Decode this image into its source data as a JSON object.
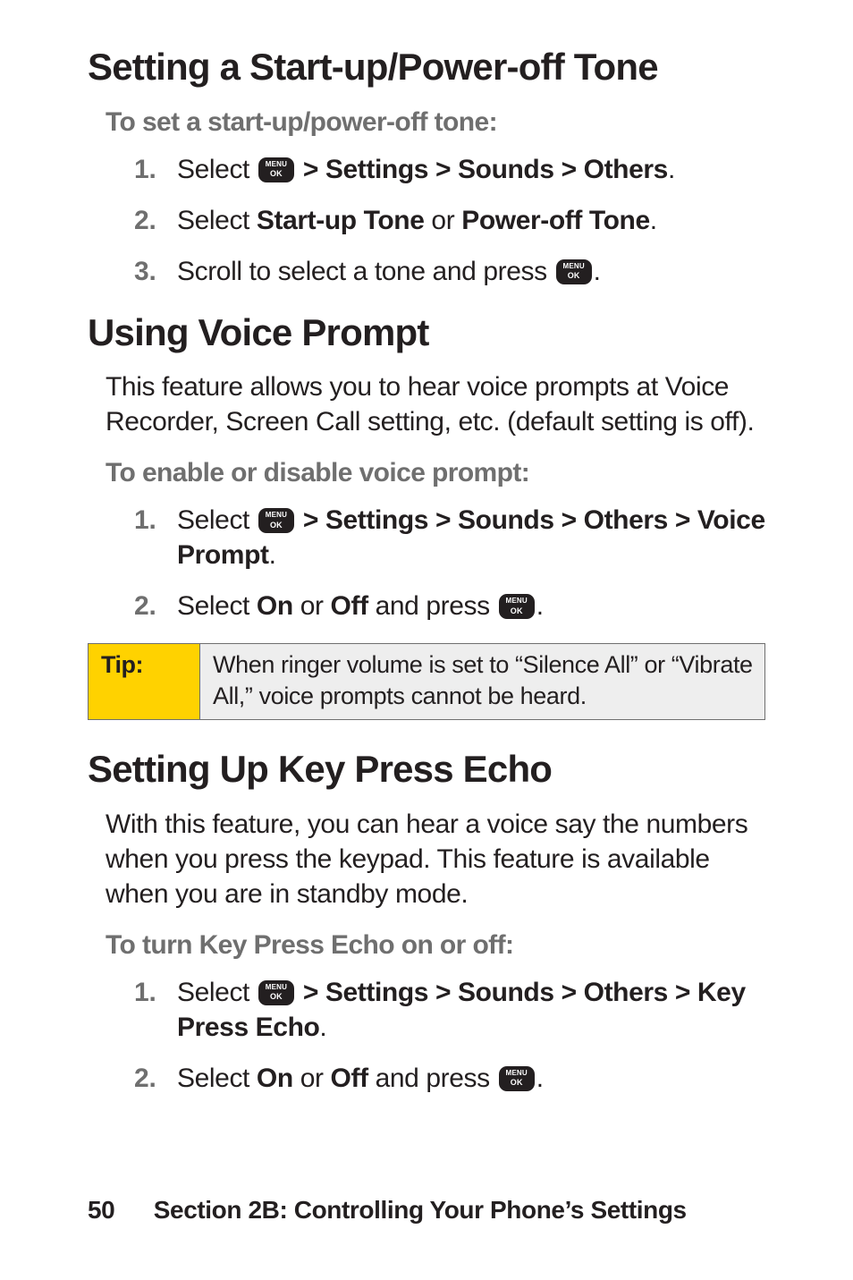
{
  "section1": {
    "heading": "Setting a Start-up/Power-off Tone",
    "subhead": "To set a start-up/power-off tone:",
    "steps": {
      "1": {
        "pre": "Select ",
        "post": " > Settings > Sounds > Others",
        "tail": "."
      },
      "2": {
        "pre": "Select ",
        "b1": "Start-up Tone",
        "mid": " or ",
        "b2": "Power-off Tone",
        "tail": "."
      },
      "3": {
        "pre": "Scroll to select a tone and press ",
        "tail": "."
      }
    }
  },
  "section2": {
    "heading": "Using Voice Prompt",
    "intro": "This feature allows you to hear voice prompts at Voice Recorder, Screen Call setting, etc. (default setting is off).",
    "subhead": "To enable or disable voice prompt:",
    "steps": {
      "1": {
        "pre": "Select ",
        "post": " > Settings > Sounds > Others > Voice Prompt",
        "tail": "."
      },
      "2": {
        "pre": "Select ",
        "b1": "On",
        "mid": " or ",
        "b2": "Off",
        "post": " and press ",
        "tail": "."
      }
    },
    "tip": {
      "label": "Tip:",
      "text": "When ringer volume is set to “Silence All” or “Vibrate All,” voice prompts cannot be heard."
    }
  },
  "section3": {
    "heading": "Setting Up Key Press Echo",
    "intro": "With this feature, you can hear a voice say the numbers when you press the keypad. This feature is available when you are in standby mode.",
    "subhead": "To turn Key Press Echo on or off:",
    "steps": {
      "1": {
        "pre": "Select ",
        "post": " > Settings > Sounds > Others > Key Press Echo",
        "tail": "."
      },
      "2": {
        "pre": "Select ",
        "b1": "On",
        "mid": " or ",
        "b2": "Off",
        "post": " and press ",
        "tail": "."
      }
    }
  },
  "footer": {
    "page": "50",
    "section": "Section 2B: Controlling Your Phone’s Settings"
  }
}
